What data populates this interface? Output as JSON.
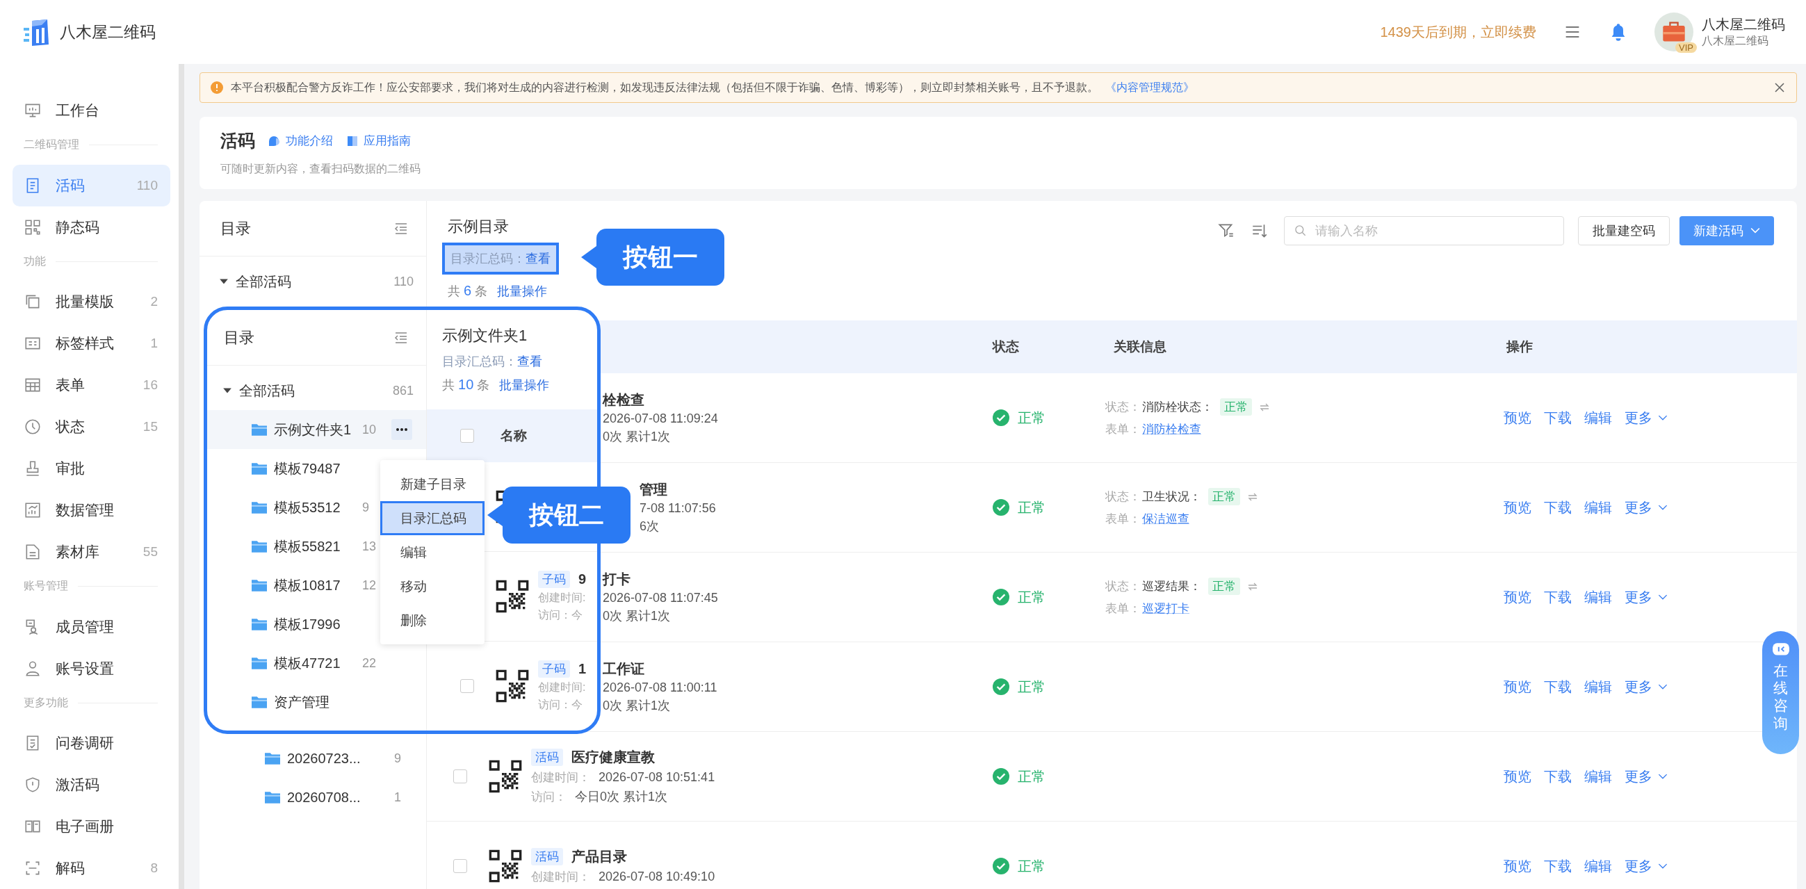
{
  "header": {
    "brand": "八木屋二维码",
    "expiry": "1439天后到期，立即续费",
    "user_name": "八木屋二维码",
    "vip_badge": "VIP",
    "user_subtitle": "八木屋二维码"
  },
  "sidebar": {
    "items": [
      {
        "kind": "item",
        "label": "工作台",
        "selected": false
      },
      {
        "kind": "section",
        "label": "二维码管理"
      },
      {
        "kind": "item",
        "label": "活码",
        "count": "110",
        "selected": true
      },
      {
        "kind": "item",
        "label": "静态码",
        "selected": false
      },
      {
        "kind": "section",
        "label": "功能"
      },
      {
        "kind": "item",
        "label": "批量模版",
        "count": "2",
        "selected": false
      },
      {
        "kind": "item",
        "label": "标签样式",
        "count": "1",
        "selected": false
      },
      {
        "kind": "item",
        "label": "表单",
        "count": "16",
        "selected": false
      },
      {
        "kind": "item",
        "label": "状态",
        "count": "15",
        "selected": false
      },
      {
        "kind": "item",
        "label": "审批",
        "selected": false
      },
      {
        "kind": "item",
        "label": "数据管理",
        "selected": false
      },
      {
        "kind": "item",
        "label": "素材库",
        "count": "55",
        "selected": false
      },
      {
        "kind": "section",
        "label": "账号管理"
      },
      {
        "kind": "item",
        "label": "成员管理",
        "selected": false
      },
      {
        "kind": "item",
        "label": "账号设置",
        "selected": false
      },
      {
        "kind": "section",
        "label": "更多功能"
      },
      {
        "kind": "item",
        "label": "问卷调研",
        "selected": false
      },
      {
        "kind": "item",
        "label": "激活码",
        "selected": false
      },
      {
        "kind": "item",
        "label": "电子画册",
        "selected": false
      },
      {
        "kind": "item",
        "label": "解码",
        "count": "8",
        "selected": false
      }
    ]
  },
  "notice": {
    "text": "本平台积极配合警方反诈工作！应公安部要求，我们将对生成的内容进行检测，如发现违反法律法规（包括但不限于诈骗、色情、博彩等），则立即封禁相关账号，且不予退款。",
    "link": "《内容管理规范》"
  },
  "page_header": {
    "title": "活码",
    "links": [
      "功能介绍",
      "应用指南"
    ],
    "description": "可随时更新内容，查看扫码数据的二维码"
  },
  "folder_panel": {
    "title": "目录",
    "root": {
      "label": "全部活码",
      "count": "110",
      "expanded": true,
      "children": [
        {
          "label": "20260723...",
          "count": "9"
        },
        {
          "label": "20260708...",
          "count": "1"
        }
      ]
    }
  },
  "list_header": {
    "title": "示例目录",
    "summary_label": "目录汇总码：",
    "summary_link": "查看",
    "count_prefix": "共",
    "count": "6",
    "count_suffix": "条",
    "batch_link": "批量操作"
  },
  "toolbar": {
    "search_placeholder": "请输入名称",
    "buttons": [
      {
        "label": "批量建空码",
        "kind": "secondary"
      },
      {
        "label": "新建活码",
        "kind": "primary"
      }
    ]
  },
  "table": {
    "columns": [
      "状态",
      "关联信息",
      "操作"
    ],
    "rows": [
      {
        "fragment": {
          "title": "栓检查",
          "created": "2026-07-08 11:09:24",
          "visits": "0次 累计1次"
        },
        "status": "正常",
        "linked": {
          "status_label": "状态：",
          "status_name": "消防栓状态：",
          "status_value": "正常",
          "form_label": "表单：",
          "form_link": "消防栓检查"
        },
        "actions": [
          "预览",
          "下载",
          "编辑"
        ],
        "more": "更多"
      },
      {
        "fragment": {
          "title": "管理",
          "created": "7-08 11:07:56",
          "visits": "6次"
        },
        "status": "正常",
        "linked": {
          "status_label": "状态：",
          "status_name": "卫生状况：",
          "status_value": "正常",
          "form_label": "表单：",
          "form_link": "保洁巡查"
        },
        "actions": [
          "预览",
          "下载",
          "编辑"
        ],
        "more": "更多"
      },
      {
        "fragment": {
          "title": "打卡",
          "created": "2026-07-08 11:07:45",
          "visits": "0次 累计1次"
        },
        "status": "正常",
        "linked": {
          "status_label": "状态：",
          "status_name": "巡逻结果：",
          "status_value": "正常",
          "form_label": "表单：",
          "form_link": "巡逻打卡"
        },
        "actions": [
          "预览",
          "下载",
          "编辑"
        ],
        "more": "更多"
      },
      {
        "fragment": {
          "title": "工作证",
          "created": "2026-07-08 11:00:11",
          "visits": "0次 累计1次"
        },
        "status": "正常",
        "actions": [
          "预览",
          "下载",
          "编辑"
        ],
        "more": "更多"
      },
      {
        "checked": false,
        "tag": "活码",
        "title": "医疗健康宣教",
        "created_label": "创建时间：",
        "created": "2026-07-08 10:51:41",
        "visits_label": "访问：",
        "visits": "今日0次 累计1次",
        "status": "正常",
        "actions": [
          "预览",
          "下载",
          "编辑"
        ],
        "more": "更多"
      },
      {
        "checked": false,
        "tag": "活码",
        "title": "产品目录",
        "created_label": "创建时间：",
        "created": "2026-07-08 10:49:10",
        "status": "正常",
        "actions": [
          "预览",
          "下载",
          "编辑"
        ],
        "more": "更多"
      }
    ]
  },
  "inset": {
    "folder_panel": {
      "title": "目录",
      "root": {
        "label": "全部活码",
        "count": "861",
        "expanded": true,
        "children": [
          {
            "label": "示例文件夹1",
            "count": "10",
            "selected": true
          },
          {
            "label": "模板79487",
            "selected": false
          },
          {
            "label": "模板53512",
            "count": "9",
            "selected": false
          },
          {
            "label": "模板55821",
            "count": "13",
            "selected": false
          },
          {
            "label": "模板10817",
            "count": "12",
            "selected": false
          },
          {
            "label": "模板17996",
            "selected": false
          },
          {
            "label": "模板47721",
            "count": "22",
            "selected": false
          },
          {
            "label": "资产管理",
            "selected": false
          }
        ]
      }
    },
    "list_header": {
      "title": "示例文件夹1",
      "summary_label": "目录汇总码：",
      "summary_link": "查看",
      "count_prefix": "共",
      "count": "10",
      "count_suffix": "条",
      "batch_link": "批量操作"
    },
    "name_column": "名称",
    "header_checked": false,
    "rows": [
      {
        "kind": "covered"
      },
      {
        "kind": "partial",
        "tag": "子码",
        "title": "9",
        "created_label": "创建时间:",
        "visits_label": "访问：今"
      },
      {
        "kind": "partial",
        "checked": false,
        "tag": "子码",
        "title": "1",
        "created_label": "创建时间:",
        "visits_label": "访问：今"
      }
    ]
  },
  "context_menu": {
    "items": [
      {
        "label": "新建子目录",
        "selected": false
      },
      {
        "label": "目录汇总码",
        "selected": true
      },
      {
        "label": "编辑",
        "selected": false
      },
      {
        "label": "移动",
        "selected": false
      },
      {
        "label": "删除",
        "selected": false
      }
    ]
  },
  "callouts": [
    "按钮一",
    "按钮二"
  ],
  "chat_widget": {
    "label": "在线咨询"
  }
}
